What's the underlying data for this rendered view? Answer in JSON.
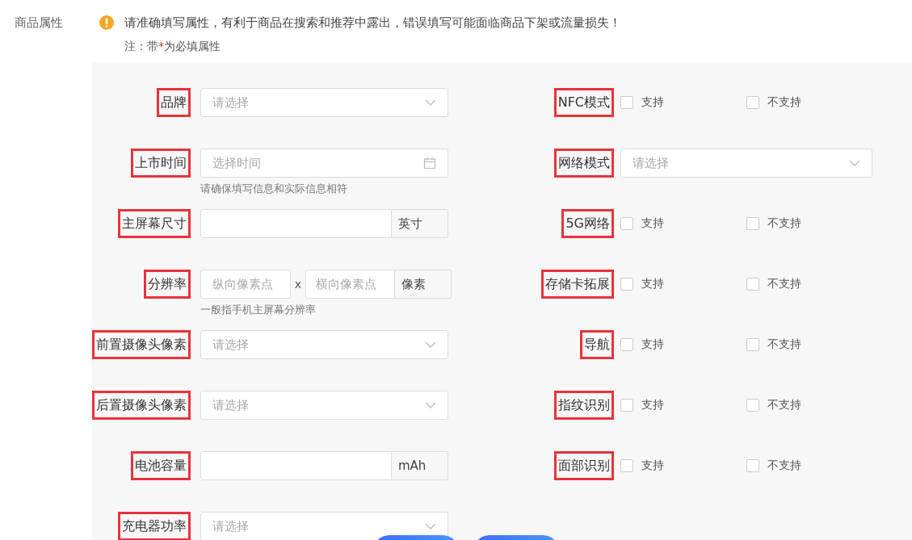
{
  "section_label": "商品属性",
  "notice": {
    "kind": "warning",
    "text": "请准确填写属性，有利于商品在搜索和推荐中露出，错误填写可能面临商品下架或流量损失！"
  },
  "note": {
    "prefix": "注：带",
    "required_mark": "*",
    "suffix": "为必填属性"
  },
  "left_fields": [
    {
      "label": "品牌",
      "highlighted": true,
      "kind": "select",
      "placeholder": "请选择"
    },
    {
      "label": "上市时间",
      "highlighted": true,
      "kind": "date",
      "placeholder": "选择时间",
      "hint": "请确保填写信息和实际信息相符"
    },
    {
      "label": "主屏幕尺寸",
      "highlighted": true,
      "kind": "unit",
      "unit": "英寸"
    },
    {
      "label": "分辨率",
      "highlighted": true,
      "kind": "resolution",
      "placeholder": "纵向像素点",
      "placeholder_2": "横向像素点",
      "separator": "x",
      "unit": "像素",
      "hint": "一般指手机主屏幕分辨率"
    },
    {
      "label": "前置摄像头像素",
      "highlighted": true,
      "kind": "select",
      "placeholder": "请选择"
    },
    {
      "label": "后置摄像头像素",
      "highlighted": true,
      "kind": "select",
      "placeholder": "请选择"
    },
    {
      "label": "电池容量",
      "highlighted": true,
      "kind": "unit",
      "unit": "mAh"
    },
    {
      "label": "充电器功率",
      "highlighted": true,
      "kind": "select",
      "placeholder": "请选择"
    }
  ],
  "right_fields": [
    {
      "label": "NFC模式",
      "highlighted": true,
      "kind": "checkbox_pair",
      "options": [
        {
          "label": "支持",
          "checked": false
        },
        {
          "label": "不支持",
          "checked": false
        }
      ]
    },
    {
      "label": "网络模式",
      "highlighted": true,
      "kind": "select",
      "placeholder": "请选择"
    },
    {
      "label": "5G网络",
      "highlighted": true,
      "kind": "checkbox_pair",
      "options": [
        {
          "label": "支持",
          "checked": false
        },
        {
          "label": "不支持",
          "checked": false
        }
      ]
    },
    {
      "label": "存储卡拓展",
      "highlighted": true,
      "kind": "checkbox_pair",
      "options": [
        {
          "label": "支持",
          "checked": false
        },
        {
          "label": "不支持",
          "checked": false
        }
      ]
    },
    {
      "label": "导航",
      "highlighted": true,
      "kind": "checkbox_pair",
      "options": [
        {
          "label": "支持",
          "checked": false
        },
        {
          "label": "不支持",
          "checked": false
        }
      ]
    },
    {
      "label": "指纹识别",
      "highlighted": true,
      "kind": "checkbox_pair",
      "options": [
        {
          "label": "支持",
          "checked": false
        },
        {
          "label": "不支持",
          "checked": false
        }
      ]
    },
    {
      "label": "面部识别",
      "highlighted": true,
      "kind": "checkbox_pair",
      "options": [
        {
          "label": "支持",
          "checked": false
        },
        {
          "label": "不支持",
          "checked": false
        }
      ]
    }
  ],
  "footer_buttons": [
    {
      "kind": "primary"
    },
    {
      "kind": "primary"
    }
  ]
}
